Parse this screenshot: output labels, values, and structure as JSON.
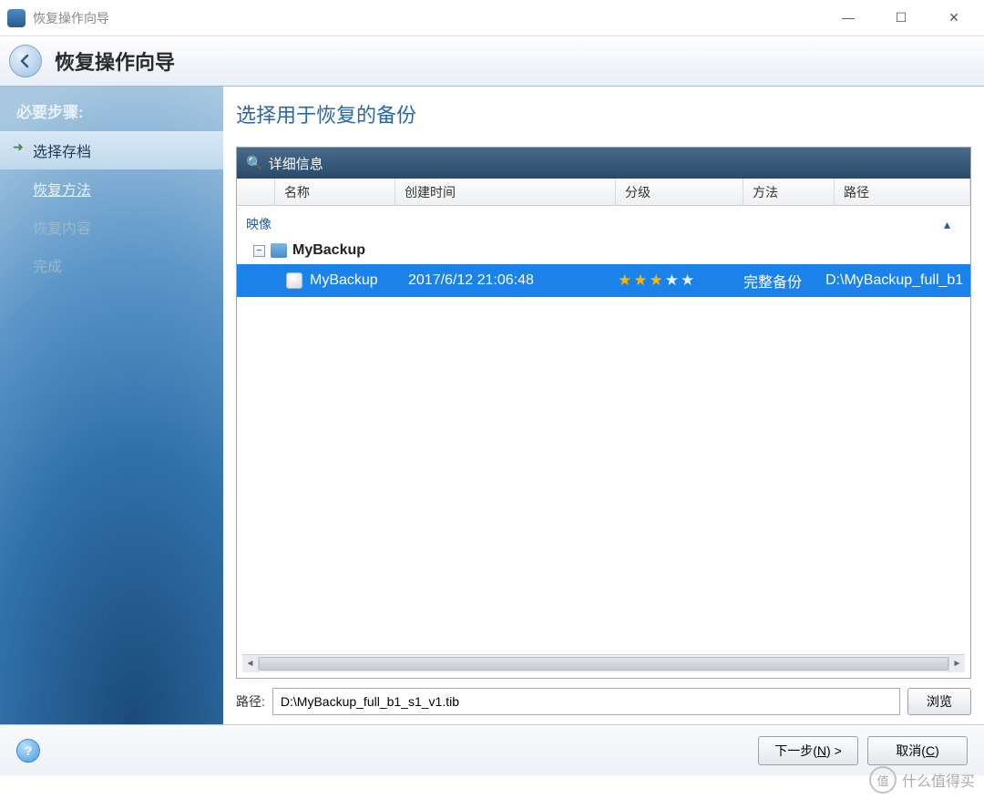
{
  "window": {
    "title": "恢复操作向导"
  },
  "header": {
    "title": "恢复操作向导"
  },
  "sidebar": {
    "title": "必要步骤:",
    "items": [
      {
        "label": "选择存档",
        "state": "active"
      },
      {
        "label": "恢复方法",
        "state": "link"
      },
      {
        "label": "恢复内容",
        "state": "disabled"
      },
      {
        "label": "完成",
        "state": "disabled"
      }
    ]
  },
  "main": {
    "title": "选择用于恢复的备份",
    "toolbar_label": "详细信息",
    "columns": {
      "name": "名称",
      "created": "创建时间",
      "rating": "分级",
      "method": "方法",
      "path": "路径"
    },
    "group": "映像",
    "tree": {
      "root_label": "MyBackup",
      "row": {
        "name": "MyBackup",
        "created": "2017/6/12 21:06:48",
        "rating": 3,
        "method": "完整备份",
        "path": "D:\\MyBackup_full_b1"
      }
    },
    "path_label": "路径:",
    "path_value": "D:\\MyBackup_full_b1_s1_v1.tib",
    "browse_label": "浏览"
  },
  "footer": {
    "next_prefix": "下一步(",
    "next_key": "N",
    "next_suffix": ") >",
    "cancel_prefix": "取消(",
    "cancel_key": "C",
    "cancel_suffix": ")"
  },
  "watermark": {
    "badge": "值",
    "text": "什么值得买"
  }
}
